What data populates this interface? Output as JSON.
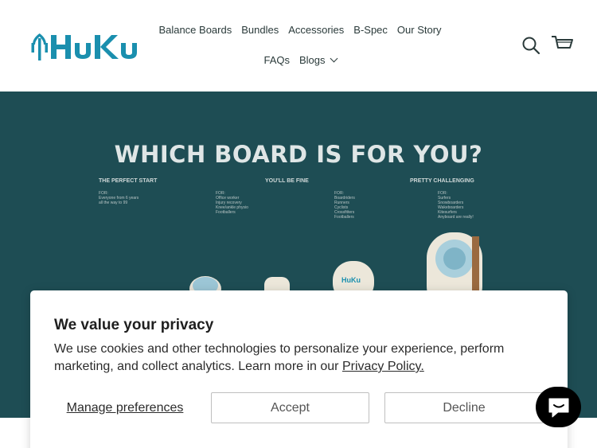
{
  "header": {
    "logo_text": "HuKu",
    "nav_row1": [
      {
        "label": "Balance Boards"
      },
      {
        "label": "Bundles"
      },
      {
        "label": "Accessories"
      },
      {
        "label": "B-Spec"
      },
      {
        "label": "Our Story"
      }
    ],
    "nav_row2": [
      {
        "label": "FAQs"
      },
      {
        "label": "Blogs"
      }
    ],
    "search_icon": "search-icon",
    "cart_icon": "cart-icon"
  },
  "hero": {
    "title": "WHICH BOARD IS FOR YOU?",
    "columns": [
      {
        "title": "THE PERFECT START",
        "text": "FOR:\nEveryone from 6 years\nall the way to 99"
      },
      {
        "title": "YOU'LL BE FINE",
        "text": "FOR:\nOffice worker\nInjury recovery\nKnee/ankle physio\nFootballers"
      },
      {
        "title": "",
        "text": "FOR:\nBoardriders\nRunners\nCyclists\nCrossfitters\nFootballers"
      },
      {
        "title": "PRETTY CHALLENGING",
        "text": "FOR:\nSurfers\nSnowboarders\nWakeboarders\nKitesurfers\nAnyboard are really!"
      }
    ],
    "board_label": "HuKu"
  },
  "cookie": {
    "title": "We value your privacy",
    "body": "We use cookies and other technologies to personalize your experience, perform marketing, and collect analytics. Learn more in our ",
    "link": "Privacy Policy.",
    "manage": "Manage preferences",
    "accept": "Accept",
    "decline": "Decline"
  },
  "chat": {
    "icon": "chat-icon"
  },
  "colors": {
    "hero_bg": "#1e4d54",
    "brand": "#1a8fae",
    "chat_bg": "#000000"
  }
}
